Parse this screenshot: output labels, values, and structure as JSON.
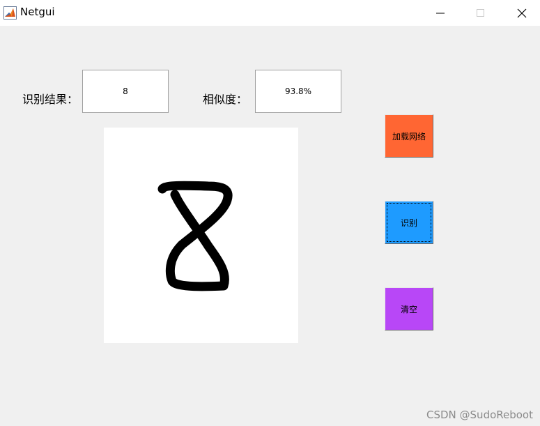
{
  "window": {
    "title": "Netgui",
    "app_icon": "matlab-icon",
    "controls": [
      "minimize-icon",
      "maximize-icon",
      "close-icon"
    ]
  },
  "result": {
    "label": "识别结果：",
    "value": "8"
  },
  "similarity": {
    "label": "相似度：",
    "value": "93.8%"
  },
  "buttons": {
    "load": {
      "label": "加载网络",
      "color": "#ff6633"
    },
    "recognize": {
      "label": "识别",
      "color": "#1e9bff"
    },
    "clear": {
      "label": "清空",
      "color": "#b847f7"
    }
  },
  "canvas": {
    "background": "#ffffff",
    "stroke_color": "#000000",
    "drawn_digit": "8"
  },
  "watermark": "CSDN @SudoReboot"
}
